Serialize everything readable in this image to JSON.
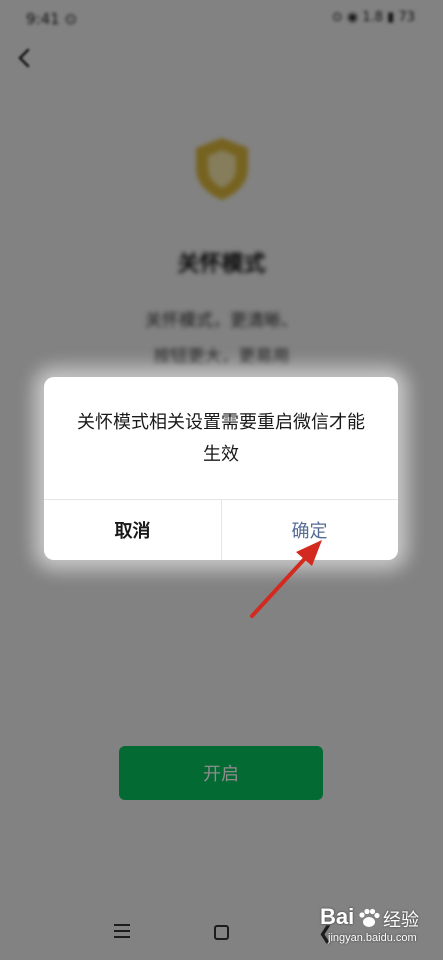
{
  "status_bar": {
    "time": "9:41 ⊙",
    "indicators": "⊙ ◉ 1.8 ▮ 73"
  },
  "care_page": {
    "title": "关怀模式",
    "description_line1": "关怀模式，更清晰、",
    "description_line2": "按钮更大，更易用",
    "open_button_label": "开启"
  },
  "dialog": {
    "message": "关怀模式相关设置需要重启微信才能生效",
    "cancel_label": "取消",
    "confirm_label": "确定"
  },
  "navigation_bar": {
    "back_glyph": "❮"
  },
  "watermark": {
    "logo_text": "Bai",
    "brand_text": "经验",
    "url_text": "jingyan.baidu.com"
  },
  "colors": {
    "wechat_green": "#07c160",
    "confirm_blue": "#576b95",
    "annotation_arrow": "#d32a1f",
    "shield_gold": "#d8b43a"
  },
  "icons": [
    "back-arrow-icon",
    "shield-icon",
    "menu-icon",
    "home-icon",
    "back-icon",
    "paw-icon",
    "annotation-arrow"
  ]
}
